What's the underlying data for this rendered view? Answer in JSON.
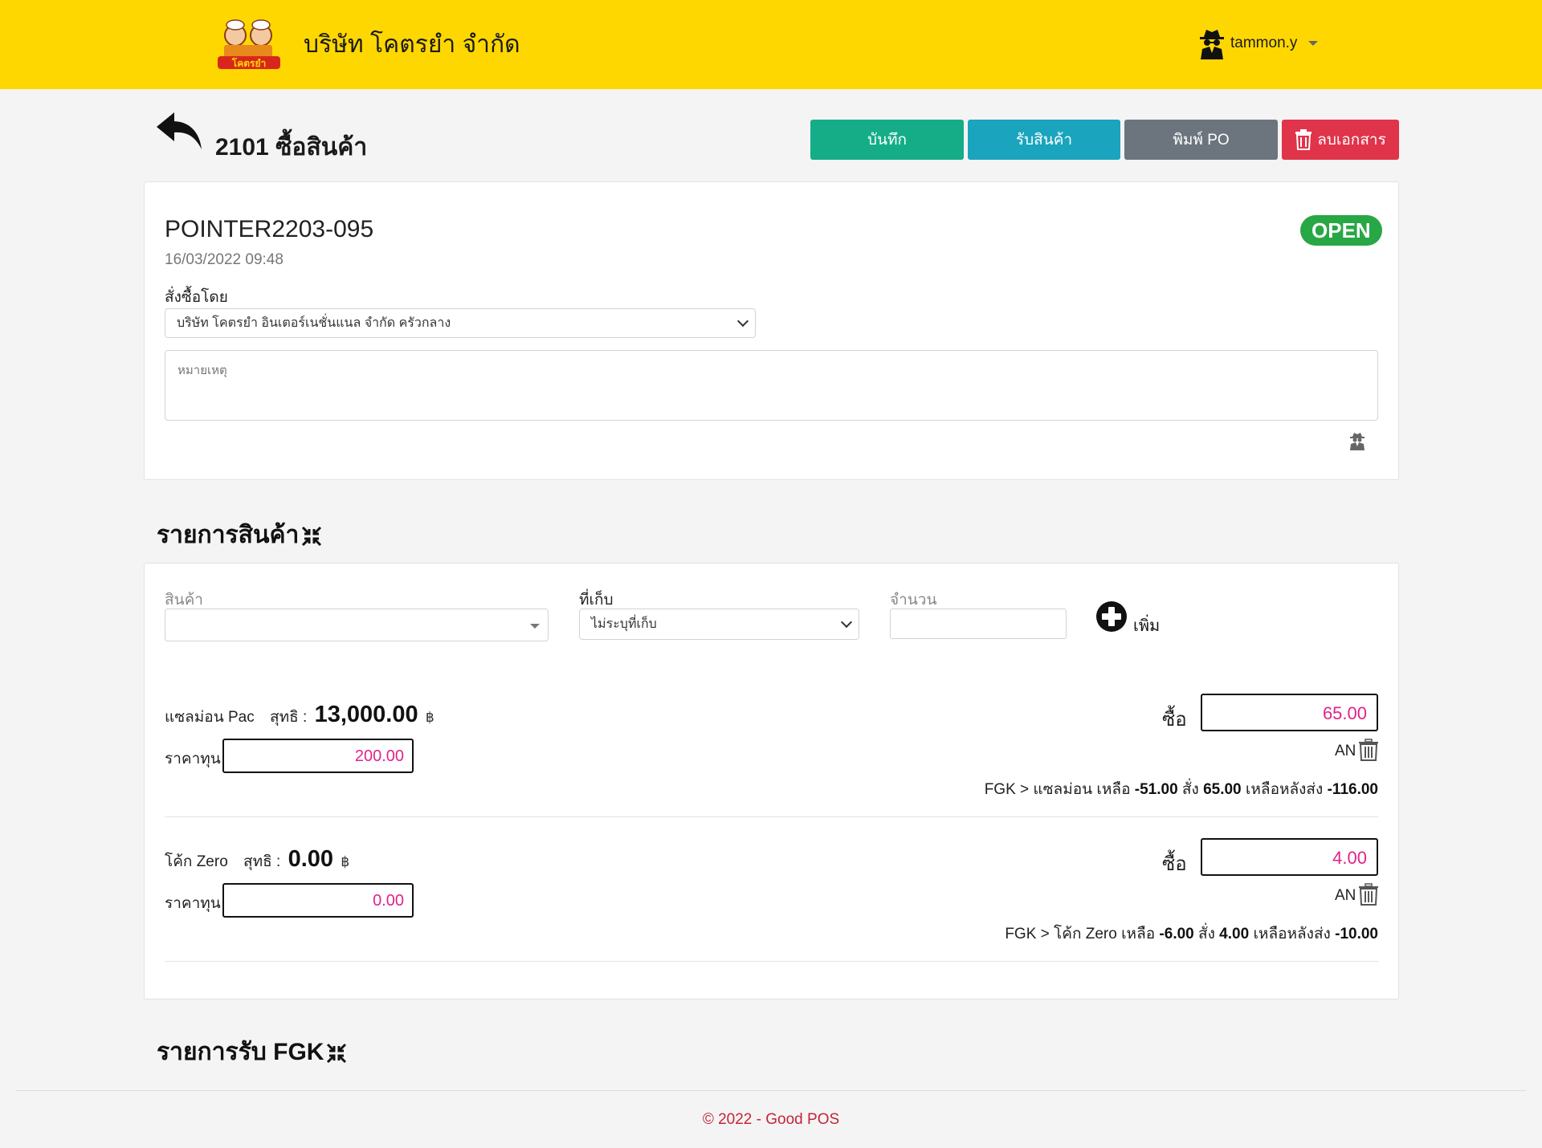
{
  "header": {
    "company_name": "บริษัท โคตรยำ จำกัด",
    "logo_text": "โคตรยำ",
    "username": "tammon.y",
    "bg_color": "#ffd700"
  },
  "page": {
    "title": "2101 ซื้อสินค้า",
    "buttons": {
      "save": "บันทึก",
      "receive": "รับสินค้า",
      "print": "พิมพ์ PO",
      "delete": "ลบเอกสาร"
    }
  },
  "document": {
    "number": "POINTER2203-095",
    "datetime": "16/03/2022 09:48",
    "status": "OPEN",
    "order_by_label": "สั่งซื้อโดย",
    "order_by_value": "บริษัท โคตรยำ อินเตอร์เนชั่นแนล จำกัด ครัวกลาง",
    "note_placeholder": "หมายเหตุ"
  },
  "items_section": {
    "title": "รายการสินค้า",
    "form": {
      "product_label": "สินค้า",
      "store_label": "ที่เก็บ",
      "store_value": "ไม่ระบุที่เก็บ",
      "qty_label": "จำนวน",
      "add_label": "เพิ่ม"
    },
    "rows": [
      {
        "name": "แซลม่อน Pac",
        "net_label": "สุทธิ :",
        "net_amount": "13,000.00",
        "currency": "฿",
        "cost_label": "ราคาทุน",
        "cost": "200.00",
        "buy_label": "ซื้อ",
        "buy_qty": "65.00",
        "unit_code": "AN",
        "stock": {
          "prefix": "FGK > แซลม่อน เหลือ",
          "remain": "-51.00",
          "order_label": "สั่ง",
          "order": "65.00",
          "after_label": "เหลือหลังส่ง",
          "after": "-116.00"
        }
      },
      {
        "name": "โค้ก Zero",
        "net_label": "สุทธิ :",
        "net_amount": "0.00",
        "currency": "฿",
        "cost_label": "ราคาทุน",
        "cost": "0.00",
        "buy_label": "ซื้อ",
        "buy_qty": "4.00",
        "unit_code": "AN",
        "stock": {
          "prefix": "FGK > โค้ก Zero เหลือ",
          "remain": "-6.00",
          "order_label": "สั่ง",
          "order": "4.00",
          "after_label": "เหลือหลังส่ง",
          "after": "-10.00"
        }
      }
    ]
  },
  "receive_section": {
    "title": "รายการรับ FGK"
  },
  "footer": {
    "text": "© 2022 - Good POS"
  },
  "colors": {
    "save": "#14ad87",
    "receive": "#1aa4bd",
    "print": "#6c757d",
    "delete": "#e0344a",
    "status": "#28a745",
    "value_pink": "#e0238c"
  }
}
